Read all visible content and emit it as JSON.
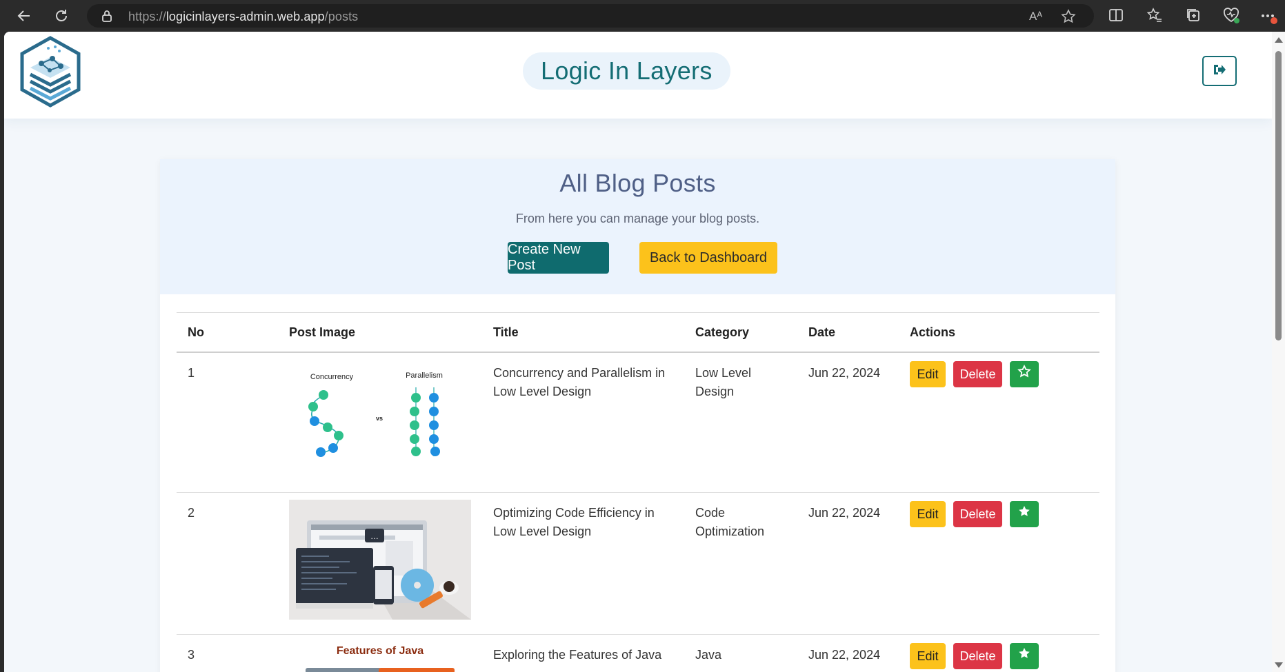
{
  "browser": {
    "url_prefix": "https://",
    "url_host": "logicinlayers-admin.web.app",
    "url_path": "/posts",
    "read_aloud_label": "Aᴬ"
  },
  "header": {
    "brand": "Logic In Layers",
    "logo_icon": "layers-logo",
    "logout_icon": "logout-icon"
  },
  "intro": {
    "title": "All Blog Posts",
    "subtitle": "From here you can manage your blog posts.",
    "create_label": "Create New Post",
    "back_label": "Back to Dashboard"
  },
  "table": {
    "columns": [
      "No",
      "Post Image",
      "Title",
      "Category",
      "Date",
      "Actions"
    ],
    "rows": [
      {
        "no": "1",
        "image": "concurrency-vs-parallelism",
        "image_labels": {
          "left": "Concurrency",
          "mid": "vs",
          "right": "Parallelism"
        },
        "title": "Concurrency and Parallelism in Low Level Design",
        "category": "Low Level Design",
        "date": "Jun 22, 2024",
        "edit": "Edit",
        "delete": "Delete",
        "featured": false
      },
      {
        "no": "2",
        "image": "devices-illustration",
        "title": "Optimizing Code Efficiency in Low Level Design",
        "category": "Code Optimization",
        "date": "Jun 22, 2024",
        "edit": "Edit",
        "delete": "Delete",
        "featured": true
      },
      {
        "no": "3",
        "image": "features-of-java",
        "image_labels": {
          "top": "Features of Java"
        },
        "title": "Exploring the Features of Java",
        "category": "Java",
        "date": "Jun 22, 2024",
        "edit": "Edit",
        "delete": "Delete",
        "featured": true
      }
    ]
  },
  "colors": {
    "teal": "#0f6b6e",
    "yellow": "#fcc21b",
    "red": "#dc3545",
    "green": "#22a24a",
    "title": "#4f5f86"
  }
}
